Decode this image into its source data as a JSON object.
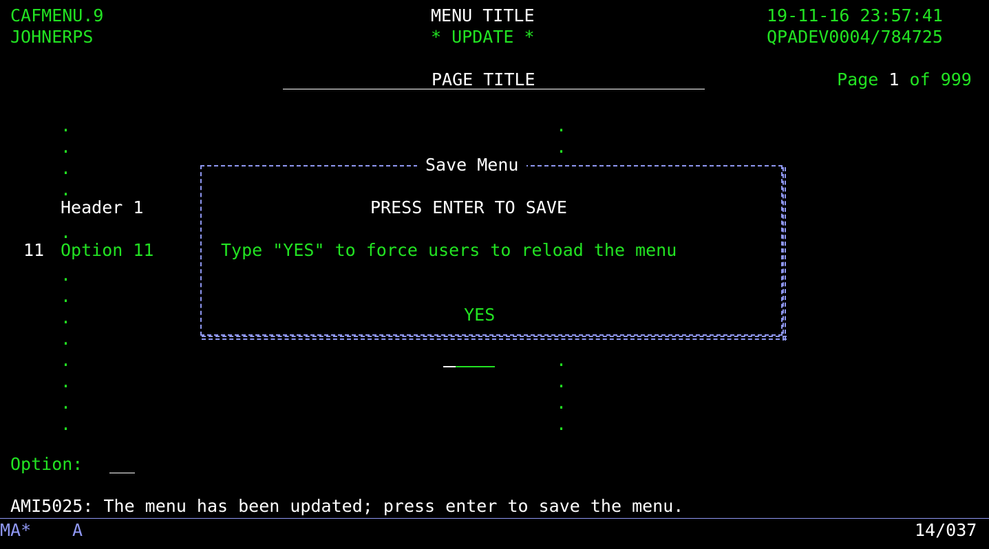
{
  "header": {
    "program": "CAFMENU.9",
    "user": "JOHNERPS",
    "menu_title": "MENU TITLE",
    "mode": "* UPDATE *",
    "datetime": "19-11-16 23:57:41",
    "device": "QPADEV0004/784725",
    "page_label": "Page",
    "page_current": "1",
    "page_of": "of",
    "page_total": "999",
    "page_title": "PAGE TITLE"
  },
  "list": {
    "dot": ".",
    "header_label": "Header 1",
    "option_number": "11",
    "option_label": "Option 11"
  },
  "dialog": {
    "title": "Save Menu",
    "instruction": "PRESS ENTER TO SAVE",
    "prompt": "Type \"YES\" to force users to reload the menu",
    "value": "YES"
  },
  "footer": {
    "option_label": "Option:",
    "message": "AMI5025: The menu has been updated; press enter to save the menu.",
    "status_left": "MA*",
    "status_mid": "A",
    "status_right": "14/037"
  },
  "colors": {
    "background": "#000000",
    "field_text": "#22e222",
    "literal_text": "#ffffff",
    "dialog_border": "#8f97f2"
  }
}
